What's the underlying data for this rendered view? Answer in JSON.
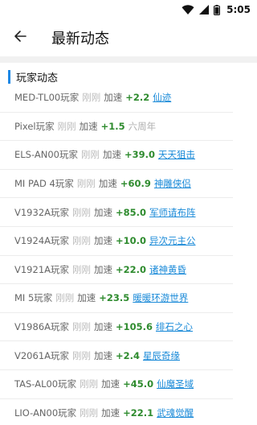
{
  "status_bar": {
    "time": "5:05",
    "icons": [
      "wifi-icon",
      "cellular-signal-icon",
      "battery-icon"
    ]
  },
  "header": {
    "back_icon": "arrow-left-icon",
    "title": "最新动态"
  },
  "section": {
    "title": "玩家动态"
  },
  "activity": [
    {
      "device": "MED-TL00玩家",
      "time": "刚刚",
      "label": "加速",
      "boost": "+2.2",
      "game": "仙迹",
      "linked": true
    },
    {
      "device": "Pixel玩家",
      "time": "刚刚",
      "label": "加速",
      "boost": "+1.5",
      "game": "六周年",
      "linked": false
    },
    {
      "device": "ELS-AN00玩家",
      "time": "刚刚",
      "label": "加速",
      "boost": "+39.0",
      "game": "天天狙击",
      "linked": true
    },
    {
      "device": "MI PAD 4玩家",
      "time": "刚刚",
      "label": "加速",
      "boost": "+60.9",
      "game": "神雕侠侣",
      "linked": true
    },
    {
      "device": "V1932A玩家",
      "time": "刚刚",
      "label": "加速",
      "boost": "+85.0",
      "game": "军师请布阵",
      "linked": true
    },
    {
      "device": "V1924A玩家",
      "time": "刚刚",
      "label": "加速",
      "boost": "+10.0",
      "game": "异次元主公",
      "linked": true
    },
    {
      "device": "V1921A玩家",
      "time": "刚刚",
      "label": "加速",
      "boost": "+22.0",
      "game": "诸神黄昏",
      "linked": true
    },
    {
      "device": "MI 5玩家",
      "time": "刚刚",
      "label": "加速",
      "boost": "+23.5",
      "game": "暖暖环游世界",
      "linked": true
    },
    {
      "device": "V1986A玩家",
      "time": "刚刚",
      "label": "加速",
      "boost": "+105.6",
      "game": "绯石之心",
      "linked": true
    },
    {
      "device": "V2061A玩家",
      "time": "刚刚",
      "label": "加速",
      "boost": "+2.4",
      "game": "星辰奇缘",
      "linked": true
    },
    {
      "device": "TAS-AL00玩家",
      "time": "刚刚",
      "label": "加速",
      "boost": "+45.0",
      "game": "仙魔圣域",
      "linked": true
    },
    {
      "device": "LIO-AN00玩家",
      "time": "刚刚",
      "label": "加速",
      "boost": "+22.1",
      "game": "武魂觉醒",
      "linked": true
    }
  ],
  "colors": {
    "accent": "#1e88e5",
    "boost": "#2e8b2e",
    "link": "#1a8ad8",
    "muted": "#bbbbbb"
  }
}
